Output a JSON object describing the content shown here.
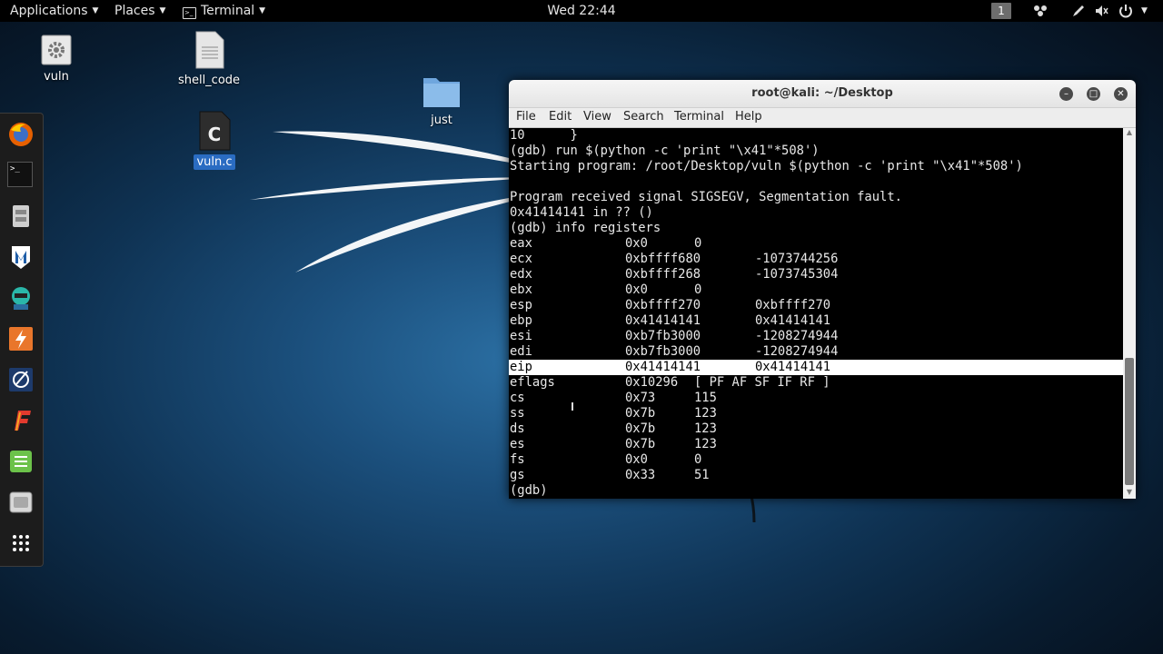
{
  "topbar": {
    "applications": "Applications",
    "places": "Places",
    "terminal": "Terminal",
    "clock": "Wed 22:44",
    "workspace": "1",
    "icons": [
      "workspace-indicator",
      "network-icon",
      "pen-icon",
      "volume-icon",
      "power-icon"
    ]
  },
  "desktop": {
    "icons": [
      {
        "label": "vuln",
        "icon": "executable-gear-icon"
      },
      {
        "label": "shell_code",
        "icon": "text-file-icon"
      },
      {
        "label": "just",
        "icon": "folder-icon"
      },
      {
        "label": "vuln.c",
        "icon": "c-source-file-icon"
      }
    ]
  },
  "dock": {
    "items": [
      "firefox-icon",
      "terminal-icon",
      "file-manager-icon",
      "metasploit-icon",
      "armitage-icon",
      "burpsuite-icon",
      "maltego-icon",
      "faraday-icon",
      "leafpad-icon",
      "cherrytree-icon",
      "show-apps-icon"
    ]
  },
  "window": {
    "title": "root@kali: ~/Desktop",
    "menu": [
      "File",
      "Edit",
      "View",
      "Search",
      "Terminal",
      "Help"
    ],
    "lines": [
      "10      }",
      "(gdb) run $(python -c 'print \"\\x41\"*508')",
      "Starting program: /root/Desktop/vuln $(python -c 'print \"\\x41\"*508')",
      "",
      "Program received signal SIGSEGV, Segmentation fault.",
      "0x41414141 in ?? ()",
      "(gdb) info registers"
    ],
    "registers": [
      {
        "name": "eax",
        "hex": "0x0",
        "value": "0"
      },
      {
        "name": "ecx",
        "hex": "0xbffff680",
        "value": "-1073744256"
      },
      {
        "name": "edx",
        "hex": "0xbffff268",
        "value": "-1073745304"
      },
      {
        "name": "ebx",
        "hex": "0x0",
        "value": "0"
      },
      {
        "name": "esp",
        "hex": "0xbffff270",
        "value": "0xbffff270"
      },
      {
        "name": "ebp",
        "hex": "0x41414141",
        "value": "0x41414141"
      },
      {
        "name": "esi",
        "hex": "0xb7fb3000",
        "value": "-1208274944"
      },
      {
        "name": "edi",
        "hex": "0xb7fb3000",
        "value": "-1208274944"
      },
      {
        "name": "eip",
        "hex": "0x41414141",
        "value": "0x41414141"
      },
      {
        "name": "eflags",
        "hex": "0x10296",
        "value": "[ PF AF SF IF RF ]"
      },
      {
        "name": "cs",
        "hex": "0x73",
        "value": "115"
      },
      {
        "name": "ss",
        "hex": "0x7b",
        "value": "123"
      },
      {
        "name": "ds",
        "hex": "0x7b",
        "value": "123"
      },
      {
        "name": "es",
        "hex": "0x7b",
        "value": "123"
      },
      {
        "name": "fs",
        "hex": "0x0",
        "value": "0"
      },
      {
        "name": "gs",
        "hex": "0x33",
        "value": "51"
      }
    ],
    "prompt": "(gdb)",
    "highlighted_register": "eip"
  }
}
